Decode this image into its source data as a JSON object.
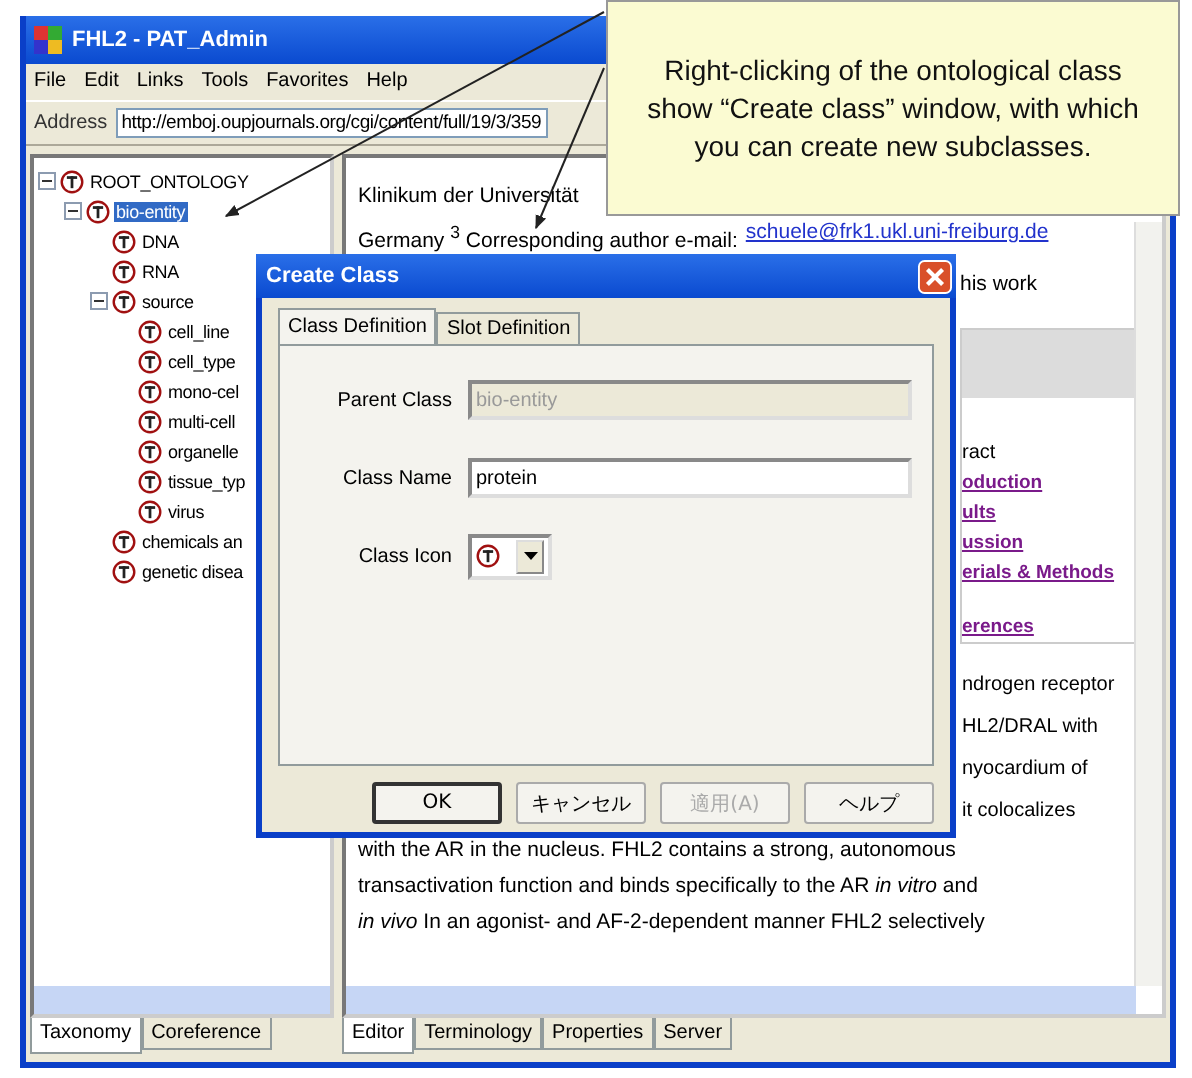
{
  "window": {
    "title": "FHL2 - PAT_Admin"
  },
  "menu": [
    "File",
    "Edit",
    "Links",
    "Tools",
    "Favorites",
    "Help"
  ],
  "address": {
    "label": "Address",
    "value": "http://emboj.oupjournals.org/cgi/content/full/19/3/359"
  },
  "tree": [
    {
      "label": "ROOT_ONTOLOGY",
      "expanded": true,
      "selected": false,
      "children": [
        {
          "label": "bio-entity",
          "expanded": true,
          "selected": true,
          "children": [
            {
              "label": "DNA",
              "selected": false
            },
            {
              "label": "RNA",
              "selected": false
            },
            {
              "label": "source",
              "expanded": true,
              "selected": false,
              "children": [
                {
                  "label": "cell_line",
                  "selected": false
                },
                {
                  "label": "cell_type",
                  "selected": false
                },
                {
                  "label": "mono-cel",
                  "selected": false
                },
                {
                  "label": "multi-cell",
                  "selected": false
                },
                {
                  "label": "organelle",
                  "selected": false
                },
                {
                  "label": "tissue_typ",
                  "selected": false
                },
                {
                  "label": "virus",
                  "selected": false
                }
              ]
            },
            {
              "label": "chemicals an",
              "selected": false
            },
            {
              "label": "genetic disea",
              "selected": false
            }
          ]
        }
      ]
    }
  ],
  "left_tabs": [
    {
      "label": "Taxonomy",
      "selected": true
    },
    {
      "label": "Coreference",
      "selected": false
    }
  ],
  "document": {
    "heading_fragment": "Klinikum der Universität",
    "affiliation": {
      "text": "Germany $^{3}$ Corresponding author e-mail:",
      "link": "schuele@frk1.ukl.uni-freiburg.de"
    },
    "fragment": "his work",
    "contents_box": {
      "heading": "ract",
      "links": [
        "oduction",
        "ults",
        "ussion",
        "erials & Methods",
        "erences"
      ]
    },
    "fragments": [
      "ndrogen receptor",
      "HL2/DRAL with",
      "nyocardium of",
      "it colocalizes"
    ],
    "paragraph_lines": [
      "with the AR in the nucleus. FHL2 contains a strong, autonomous",
      "transactivation function and binds specifically to the AR *in vitro* and",
      "*in vivo* In an agonist- and AF-2-dependent manner FHL2 selectively"
    ]
  },
  "right_tabs": [
    {
      "label": "Editor",
      "selected": true
    },
    {
      "label": "Terminology",
      "selected": false
    },
    {
      "label": "Properties",
      "selected": false
    },
    {
      "label": "Server",
      "selected": false
    }
  ],
  "dialog": {
    "title": "Create Class",
    "tabs": [
      {
        "label": "Class Definition",
        "selected": true
      },
      {
        "label": "Slot Definition",
        "selected": false
      }
    ],
    "fields": [
      {
        "kind": "text",
        "label": "Parent Class",
        "value": "bio-entity",
        "disabled": true
      },
      {
        "kind": "text",
        "label": "Class Name",
        "value": "protein",
        "disabled": false
      },
      {
        "kind": "icon-select",
        "label": "Class Icon"
      }
    ],
    "buttons": [
      {
        "label": "OK",
        "disabled": false,
        "default": true
      },
      {
        "label": "キャンセル",
        "disabled": false,
        "default": false
      },
      {
        "label": "適用(A)",
        "disabled": true,
        "default": false
      },
      {
        "label": "ヘルプ",
        "disabled": false,
        "default": false
      }
    ]
  },
  "callout": {
    "text": "Right-clicking of the ontological class show “Create class” window, with which you can create new subclasses."
  }
}
